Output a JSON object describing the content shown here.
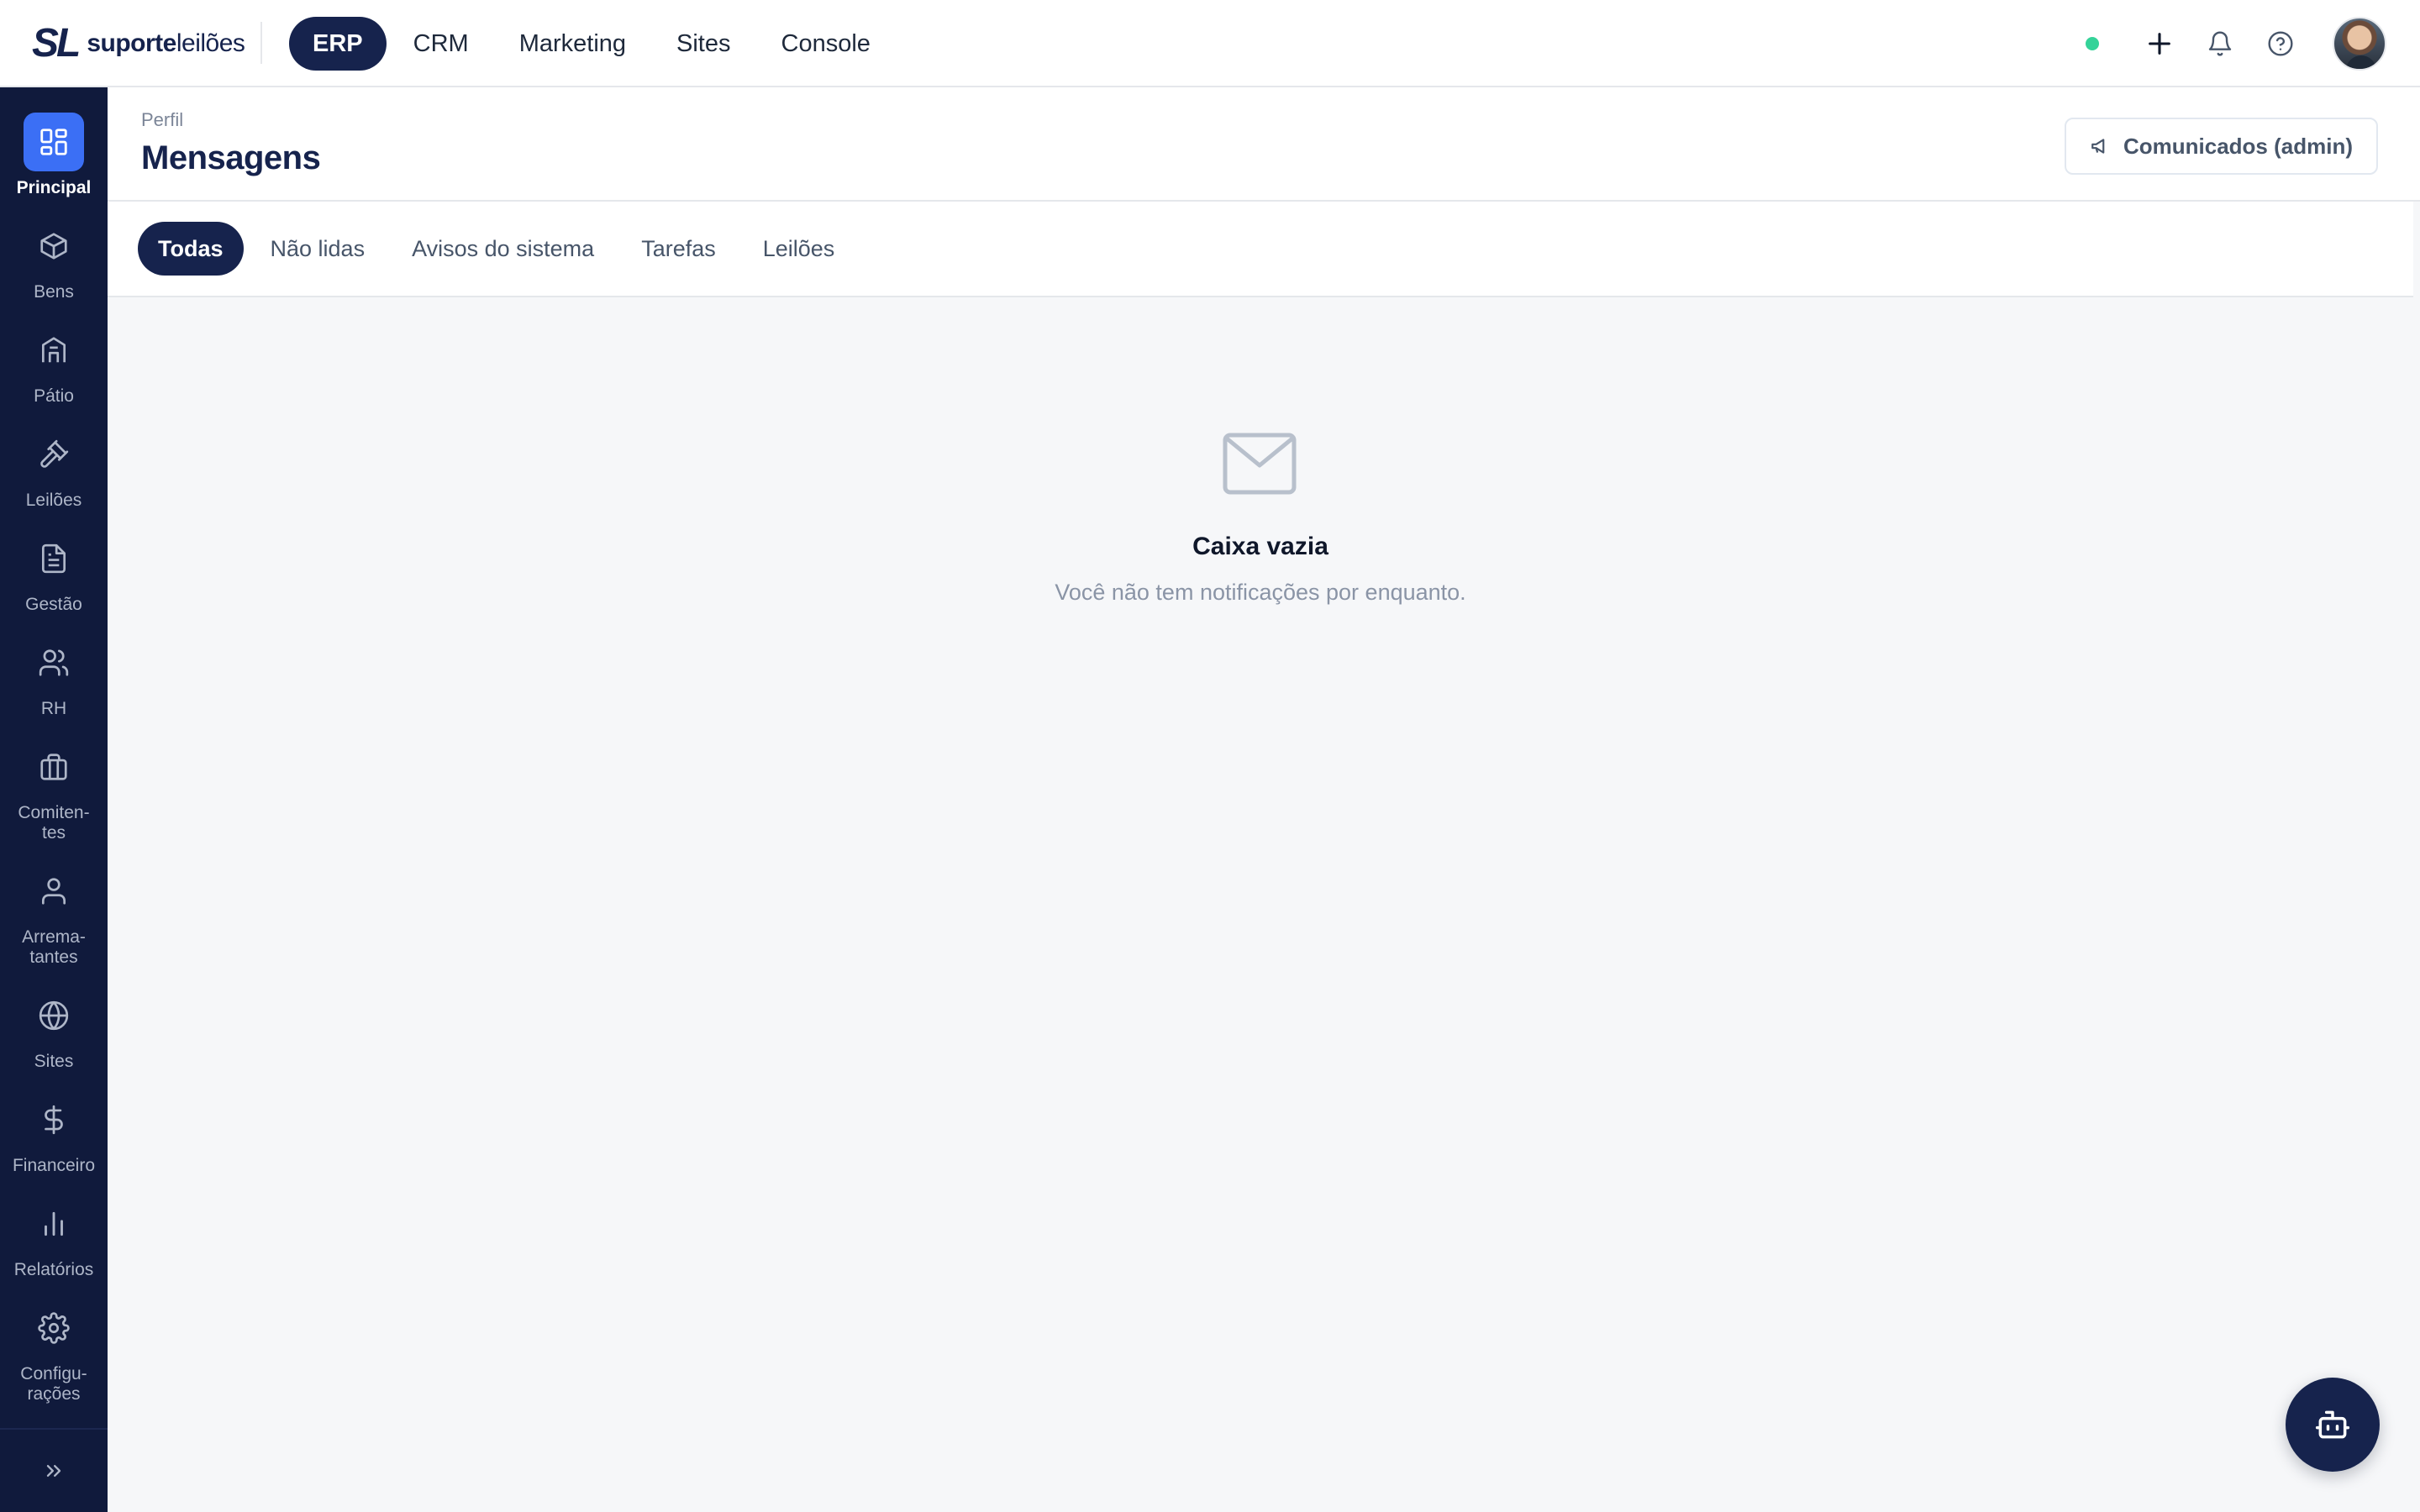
{
  "brand": {
    "mark": "SL",
    "name_bold": "suporte",
    "name_light": "leilões"
  },
  "topnav": [
    {
      "label": "ERP",
      "active": true
    },
    {
      "label": "CRM",
      "active": false
    },
    {
      "label": "Marketing",
      "active": false
    },
    {
      "label": "Sites",
      "active": false
    },
    {
      "label": "Console",
      "active": false
    }
  ],
  "topbar_icons": [
    "status-dot",
    "plus-icon",
    "bell-icon",
    "help-icon",
    "avatar"
  ],
  "sidebar": {
    "items": [
      {
        "label": "Principal",
        "icon": "dashboard-icon",
        "active": true
      },
      {
        "label": "Bens",
        "icon": "box-icon",
        "active": false
      },
      {
        "label": "Pátio",
        "icon": "warehouse-icon",
        "active": false
      },
      {
        "label": "Leilões",
        "icon": "gavel-icon",
        "active": false
      },
      {
        "label": "Gestão",
        "icon": "document-icon",
        "active": false
      },
      {
        "label": "RH",
        "icon": "users-icon",
        "active": false
      },
      {
        "label": "Comiten-\ntes",
        "icon": "briefcase-icon",
        "active": false
      },
      {
        "label": "Arrema-\ntantes",
        "icon": "user-icon",
        "active": false
      },
      {
        "label": "Sites",
        "icon": "globe-icon",
        "active": false
      },
      {
        "label": "Financeiro",
        "icon": "dollar-icon",
        "active": false
      },
      {
        "label": "Relatórios",
        "icon": "bar-chart-icon",
        "active": false
      },
      {
        "label": "Configu-\nrações",
        "icon": "gear-icon",
        "active": false
      }
    ],
    "collapse_icon": "chevrons-right-icon"
  },
  "header": {
    "breadcrumb": "Perfil",
    "title": "Mensagens",
    "admin_button": "Comunicados (admin)"
  },
  "tabs": [
    {
      "label": "Todas",
      "active": true
    },
    {
      "label": "Não lidas",
      "active": false
    },
    {
      "label": "Avisos do sistema",
      "active": false
    },
    {
      "label": "Tarefas",
      "active": false
    },
    {
      "label": "Leilões",
      "active": false
    }
  ],
  "empty_state": {
    "icon": "mail-icon",
    "title": "Caixa vazia",
    "subtitle": "Você não tem notificações por enquanto."
  },
  "floating": {
    "icon": "bot-icon"
  },
  "colors": {
    "navy": "#16234d",
    "sidebar_bg": "#101a3c",
    "accent_blue": "#3b6ff5",
    "status_green": "#34d399"
  }
}
